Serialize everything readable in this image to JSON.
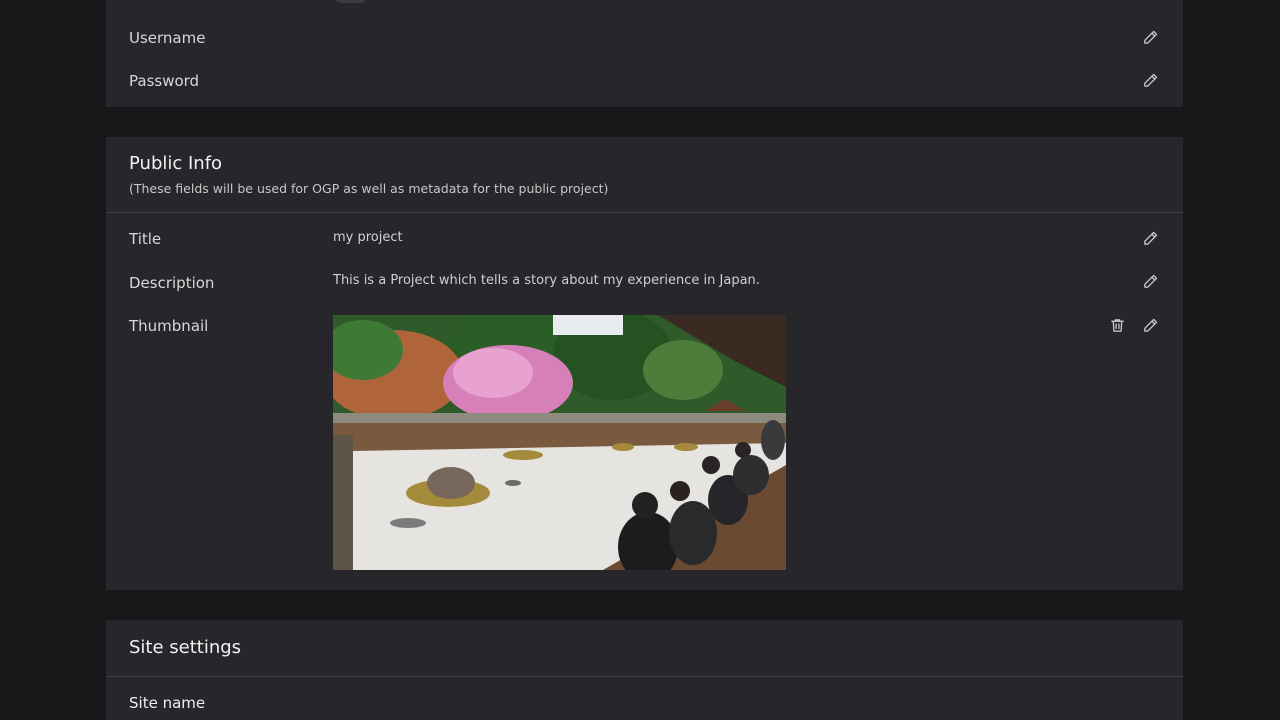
{
  "account": {
    "rows": [
      {
        "label": "Username"
      },
      {
        "label": "Password"
      }
    ]
  },
  "public_info": {
    "title": "Public Info",
    "subtitle": "(These fields will be used for OGP as well as metadata for the public project)",
    "fields": {
      "title": {
        "label": "Title",
        "value": "my project"
      },
      "description": {
        "label": "Description",
        "value": "This is a Project which tells a story about my experience in Japan."
      },
      "thumbnail": {
        "label": "Thumbnail",
        "image_alt": "Rock garden with cherry blossoms and visitors seated on a veranda"
      }
    }
  },
  "site_settings": {
    "title": "Site settings",
    "rows": [
      {
        "label": "Site name"
      }
    ]
  },
  "icons": {
    "edit": "pencil-icon",
    "delete": "trash-icon"
  }
}
